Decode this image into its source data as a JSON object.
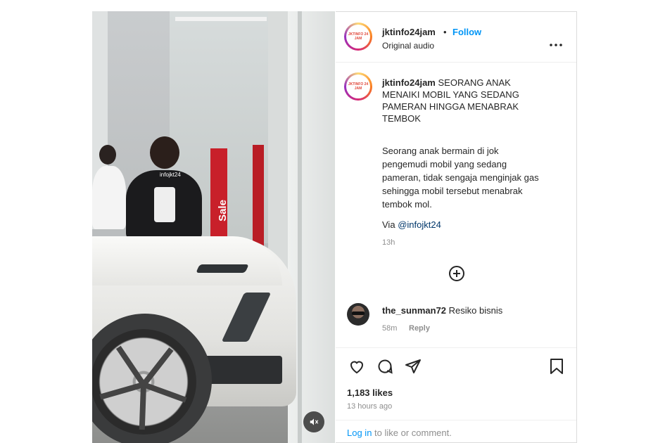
{
  "video": {
    "watermark": "infojkt24",
    "sign_text": "Sale",
    "mute_icon": "speaker-muted-icon"
  },
  "header": {
    "username": "jktinfo24jam",
    "dot": "•",
    "follow_label": "Follow",
    "audio_label": "Original audio",
    "more_icon": "more-horizontal-icon",
    "avatar_text": "JKTINFO 24 JAM"
  },
  "caption": {
    "username": "jktinfo24jam",
    "title_lines": [
      "SEORANG ANAK",
      "MENAIKI MOBIL YANG SEDANG",
      "PAMERAN HINGGA MENABRAK",
      "TEMBOK"
    ],
    "body_lines": [
      "Seorang anak bermain di jok",
      "pengemudi mobil yang sedang",
      "pameran, tidak sengaja menginjak gas",
      "sehingga mobil tersebut menabrak",
      "tembok mol."
    ],
    "via_label": "Via",
    "via_link": "@infojkt24",
    "time": "13h"
  },
  "load_more_icon": "plus-circle-icon",
  "comments": [
    {
      "username": "the_sunman72",
      "text": "Resiko bisnis",
      "time": "58m",
      "reply_label": "Reply"
    }
  ],
  "actions": {
    "like_icon": "heart-icon",
    "comment_icon": "comment-icon",
    "share_icon": "send-icon",
    "save_icon": "bookmark-icon",
    "likes": "1,183 likes",
    "timestamp": "13 hours ago"
  },
  "footer": {
    "login_label": "Log in",
    "rest_text": "to like or comment."
  },
  "colors": {
    "link": "#0095f6",
    "muted": "#8e8e8e",
    "text": "#262626"
  }
}
